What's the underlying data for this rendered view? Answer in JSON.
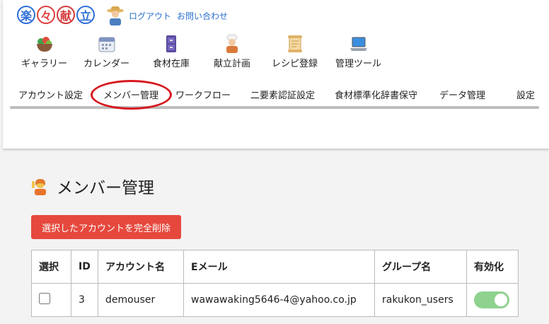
{
  "logo": {
    "chars": [
      "楽",
      "々",
      "献",
      "立"
    ]
  },
  "top_links": {
    "logout": "ログアウト",
    "contact": "お問い合わせ"
  },
  "main_nav": [
    {
      "label": "ギャラリー",
      "icon": "salad-bowl-icon"
    },
    {
      "label": "カレンダー",
      "icon": "calendar-icon"
    },
    {
      "label": "食材在庫",
      "icon": "storage-cabinet-icon"
    },
    {
      "label": "献立計画",
      "icon": "chef-icon"
    },
    {
      "label": "レシピ登録",
      "icon": "scroll-icon"
    },
    {
      "label": "管理ツール",
      "icon": "laptop-icon"
    }
  ],
  "sub_nav": [
    "アカウント設定",
    "メンバー管理",
    "ワークフロー",
    "二要素認証設定",
    "食材標準化辞書保守",
    "データ管理",
    "設定"
  ],
  "page": {
    "title": "メンバー管理",
    "delete_button": "選択したアカウントを完全削除"
  },
  "table": {
    "headers": [
      "選択",
      "ID",
      "アカウント名",
      "Eメール",
      "グループ名",
      "有効化"
    ],
    "rows": [
      {
        "id": "3",
        "account": "demouser",
        "email": "wawawaking5646-4@yahoo.co.jp",
        "group": "rakukon_users",
        "enabled": true,
        "selected": false
      }
    ]
  },
  "colors": {
    "link": "#2a6fcf",
    "danger": "#e6483d",
    "toggle_on": "#8fd28f",
    "highlight": "#d71920"
  }
}
